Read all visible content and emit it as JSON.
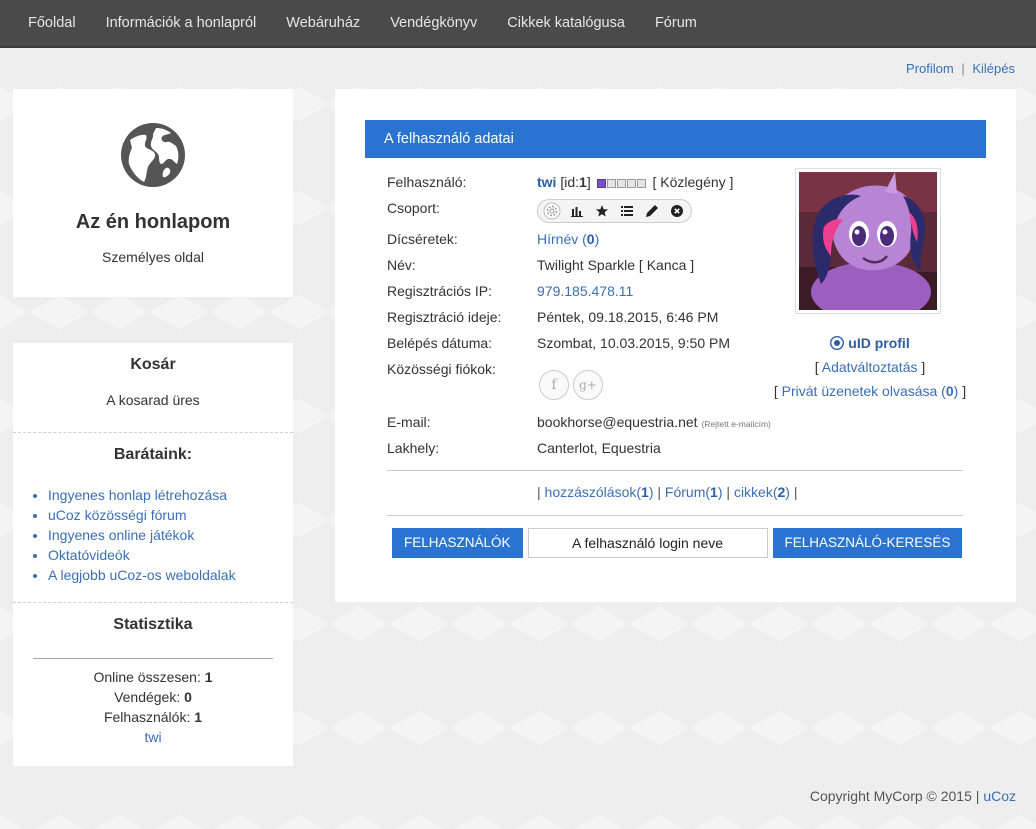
{
  "nav": {
    "items": [
      "Főoldal",
      "Információk a honlapról",
      "Webáruház",
      "Vendégkönyv",
      "Cikkek katalógusa",
      "Fórum"
    ]
  },
  "userbar": {
    "profile": "Profilom",
    "sep": "|",
    "logout": "Kilépés"
  },
  "site": {
    "title": "Az én honlapom",
    "subtitle": "Személyes oldal"
  },
  "cart": {
    "title": "Kosár",
    "empty": "A kosarad üres"
  },
  "friends": {
    "title": "Barátaink:",
    "links": [
      "Ingyenes honlap létrehozása",
      "uCoz közösségi fórum",
      "Ingyenes online játékok",
      "Oktatóvideók",
      "A legjobb uCoz-os weboldalak"
    ]
  },
  "stats": {
    "title": "Statisztika",
    "online_label": "Online összesen:",
    "online_value": "1",
    "guests_label": "Vendégek:",
    "guests_value": "0",
    "users_label": "Felhasználók:",
    "users_value": "1",
    "online_user": "twi"
  },
  "profile": {
    "header": "A felhasználó adatai",
    "labels": {
      "user": "Felhasználó:",
      "group": "Csoport:",
      "praise": "Dícséretek:",
      "name": "Név:",
      "reg_ip": "Regisztrációs IP:",
      "reg_date": "Regisztráció ideje:",
      "login_date": "Belépés dátuma:",
      "social": "Közösségi fiókok:",
      "email": "E-mail:",
      "location": "Lakhely:"
    },
    "username": "twi",
    "id_prefix": "[id:",
    "id_value": "1",
    "id_suffix": "]",
    "rank_filled": 1,
    "rank_total": 5,
    "rank_label": "[ Közlegény ]",
    "praise_link": "Hírnév",
    "praise_open": "(",
    "praise_value": "0",
    "praise_close": ")",
    "name_value": "Twilight Sparkle [ Kanca ]",
    "reg_ip_value": "979.185.478.11",
    "reg_date_value": "Péntek, 09.18.2015, 6:46 PM",
    "login_date_value": "Szombat, 10.03.2015, 9:50 PM",
    "social_facebook": "f",
    "social_google": "g+",
    "email_value": "bookhorse@equestria.net",
    "email_note": "(Rejtett e-mailcím)",
    "location_value": "Canterlot, Equestria",
    "group_icons": [
      "gear-icon",
      "bar-chart-icon",
      "star-icon",
      "list-icon",
      "pencil-icon",
      "close-circle-icon"
    ],
    "uid_profile": "uID profil",
    "edit_open": "[",
    "edit_link": "Adatváltoztatás",
    "edit_close": "]",
    "pm_open": "[",
    "pm_link": "Privát üzenetek olvasása (",
    "pm_count": "0",
    "pm_link_close": ")",
    "pm_close": "]",
    "links": {
      "pipe": "|",
      "comments": "hozzászólások(",
      "comments_count": "1",
      "comments_close": ")",
      "forum": "Fórum(",
      "forum_count": "1",
      "forum_close": ")",
      "articles": "cikkek(",
      "articles_count": "2",
      "articles_close": ")"
    }
  },
  "search": {
    "users_button": "FELHASZNÁLÓK",
    "input_value": "A felhasználó login neve",
    "search_button": "FELHASZNÁLÓ-KERESÉS"
  },
  "footer": {
    "copyright": "Copyright MyCorp © 2015",
    "sep": "|",
    "link": "uCoz"
  },
  "colors": {
    "nav_bg": "#4a4a4a",
    "accent": "#2b73d1",
    "link": "#3a6fb5"
  }
}
